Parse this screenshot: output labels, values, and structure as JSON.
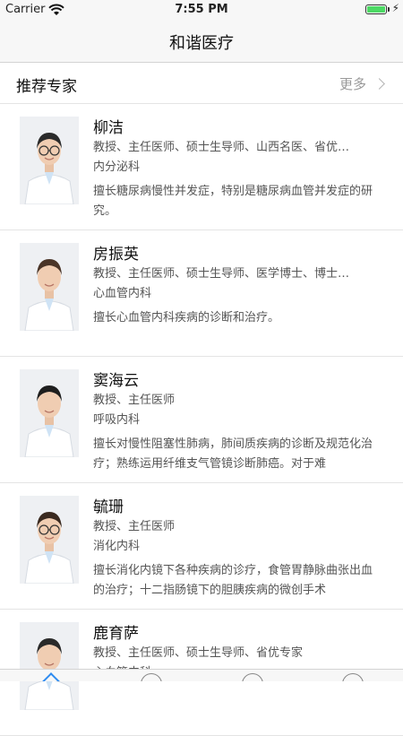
{
  "status_bar": {
    "carrier": "Carrier",
    "time": "7:55 PM",
    "battery_icon": "battery-charging-icon"
  },
  "nav": {
    "title": "和谐医疗"
  },
  "section": {
    "title": "推荐专家",
    "more_label": "更多"
  },
  "doctors": [
    {
      "name": "柳洁",
      "titles": "教授、主任医师、硕士生导师、山西名医、省优…",
      "dept": "内分泌科",
      "desc": "擅长糖尿病慢性并发症，特别是糖尿病血管并发症的研究。",
      "hair": "#2b2b2b",
      "glasses": true
    },
    {
      "name": "房振英",
      "titles": "教授、主任医师、硕士生导师、医学博士、博士…",
      "dept": "心血管内科",
      "desc": "擅长心血管内科疾病的诊断和治疗。",
      "hair": "#4a3528",
      "glasses": false
    },
    {
      "name": "窦海云",
      "titles": "教授、主任医师",
      "dept": "呼吸内科",
      "desc": "擅长对慢性阻塞性肺病，肺间质疾病的诊断及规范化治疗；熟练运用纤维支气管镜诊断肺癌。对于难",
      "hair": "#1e1e1e",
      "glasses": false
    },
    {
      "name": "毓珊",
      "titles": "教授、主任医师",
      "dept": "消化内科",
      "desc": "擅长消化内镜下各种疾病的诊疗，食管胃静脉曲张出血的治疗；十二指肠镜下的胆胰疾病的微创手术",
      "hair": "#3a2a20",
      "glasses": true
    },
    {
      "name": "鹿育萨",
      "titles": "教授、主任医师、硕士生导师、省优专家",
      "dept": "心血管内科",
      "desc": "",
      "hair": "#2a2a2a",
      "glasses": false
    }
  ],
  "tab_bar": {
    "items": [
      "home-icon",
      "info-icon",
      "tab-icon-3",
      "tab-icon-4"
    ]
  }
}
